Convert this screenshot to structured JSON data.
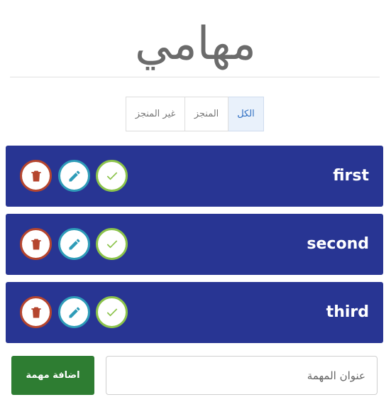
{
  "header": {
    "title": "مهامي"
  },
  "filters": [
    {
      "label": "الكل",
      "active": true
    },
    {
      "label": "المنجز",
      "active": false
    },
    {
      "label": "غير المنجز",
      "active": false
    }
  ],
  "tasks": [
    {
      "title": "first"
    },
    {
      "title": "second"
    },
    {
      "title": "third"
    }
  ],
  "form": {
    "add_label": "اضافة مهمة",
    "input_placeholder": "عنوان المهمة",
    "input_value": ""
  },
  "colors": {
    "task_bg": "#283593",
    "delete": "#b5452e",
    "edit": "#2e9cb8",
    "done": "#8bc34a",
    "add_button": "#2e7d32",
    "active_filter_text": "#2e6ec2"
  },
  "icons": {
    "delete": "trash-icon",
    "edit": "pencil-icon",
    "done": "check-icon"
  }
}
